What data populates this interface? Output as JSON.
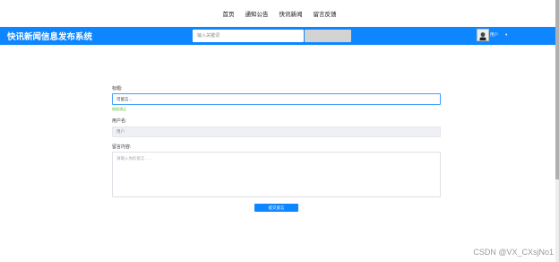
{
  "topnav": {
    "items": [
      {
        "label": "首页"
      },
      {
        "label": "通知公告"
      },
      {
        "label": "快讯新闻"
      },
      {
        "label": "留言反馈"
      }
    ]
  },
  "header": {
    "site_title": "快讯新闻信息发布系统",
    "search": {
      "placeholder": "输入关键词",
      "value": ""
    },
    "user": {
      "name": "用户"
    },
    "colors": {
      "header_bg": "#0d86ff",
      "search_button_bg": "#d3d3d3"
    }
  },
  "form": {
    "title_label": "标题:",
    "title_value": "可留言...",
    "title_hint": "格格满足",
    "username_label": "用户名:",
    "username_value": "用户",
    "content_label": "留言内容:",
    "content_placeholder": "请输入你的留言...",
    "submit_label": "提交留言"
  },
  "watermark": "CSDN @VX_CXsjNo1"
}
